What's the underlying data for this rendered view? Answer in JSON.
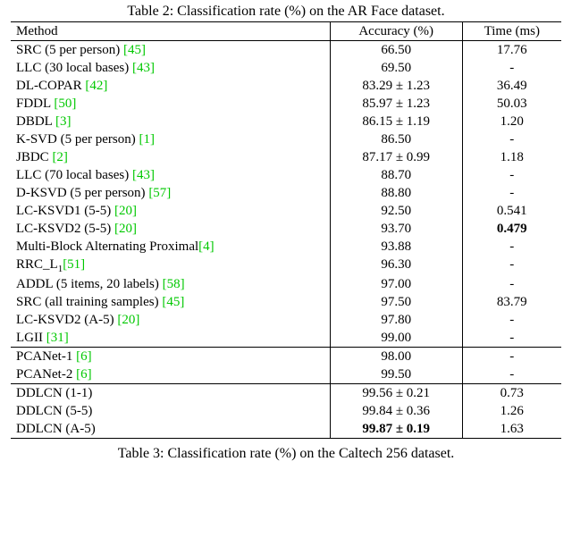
{
  "caption": "Table 2: Classification rate (%) on the AR Face dataset.",
  "post_caption": "Table 3: Classification rate (%) on the Caltech 256 dataset.",
  "headers": {
    "method": "Method",
    "accuracy": "Accuracy (%)",
    "time": "Time (ms)"
  },
  "groups": [
    {
      "rows": [
        {
          "name": "SRC (5 per person) ",
          "cite": "[45]",
          "acc": "66.50",
          "time": "17.76"
        },
        {
          "name": "LLC (30 local bases) ",
          "cite": "[43]",
          "acc": "69.50",
          "time": "-"
        },
        {
          "name": "DL-COPAR ",
          "cite": "[42]",
          "acc": "83.29 ± 1.23",
          "time": "36.49"
        },
        {
          "name": "FDDL ",
          "cite": "[50]",
          "acc": "85.97 ± 1.23",
          "time": "50.03"
        },
        {
          "name": "DBDL ",
          "cite": "[3]",
          "acc": "86.15 ± 1.19",
          "time": "1.20"
        },
        {
          "name": "K-SVD (5 per person) ",
          "cite": "[1]",
          "acc": "86.50",
          "time": "-"
        },
        {
          "name": "JBDC ",
          "cite": "[2]",
          "acc": "87.17 ± 0.99",
          "time": "1.18"
        },
        {
          "name": "LLC (70 local bases) ",
          "cite": "[43]",
          "acc": "88.70",
          "time": "-"
        },
        {
          "name": "D-KSVD (5 per person) ",
          "cite": "[57]",
          "acc": "88.80",
          "time": "-"
        },
        {
          "name": "LC-KSVD1 (5-5) ",
          "cite": "[20]",
          "acc": "92.50",
          "time": "0.541"
        },
        {
          "name": "LC-KSVD2 (5-5) ",
          "cite": "[20]",
          "acc": "93.70",
          "time_bold": "0.479"
        },
        {
          "name": "Multi-Block Alternating Proximal",
          "cite": "[4]",
          "acc": "93.88",
          "time": "-"
        },
        {
          "name_special": "RRC_L1",
          "cite": "[51]",
          "acc": "96.30",
          "time": "-"
        },
        {
          "name": "ADDL (5 items, 20 labels) ",
          "cite": "[58]",
          "acc": "97.00",
          "time": "-"
        },
        {
          "name": "SRC (all training samples) ",
          "cite": "[45]",
          "acc": "97.50",
          "time": "83.79"
        },
        {
          "name": "LC-KSVD2 (A-5) ",
          "cite": "[20]",
          "acc": "97.80",
          "time": "-"
        },
        {
          "name": "LGII ",
          "cite": "[31]",
          "acc": "99.00",
          "time": "-"
        }
      ]
    },
    {
      "rows": [
        {
          "name": "PCANet-1 ",
          "cite": "[6]",
          "acc": "98.00",
          "time": "-"
        },
        {
          "name": "PCANet-2 ",
          "cite": "[6]",
          "acc": "99.50",
          "time": "-"
        }
      ]
    },
    {
      "rows": [
        {
          "name": "DDLCN (1-1)",
          "acc": "99.56 ± 0.21",
          "time": "0.73"
        },
        {
          "name": "DDLCN (5-5)",
          "acc": "99.84 ± 0.36",
          "time": "1.26"
        },
        {
          "name": "DDLCN (A-5)",
          "acc_bold": "99.87 ± 0.19",
          "time": "1.63"
        }
      ]
    }
  ],
  "chart_data": {
    "type": "table",
    "title": "Classification rate (%) on the AR Face dataset",
    "columns": [
      "Method",
      "Accuracy (%)",
      "Time (ms)"
    ],
    "rows": [
      [
        "SRC (5 per person) [45]",
        "66.50",
        "17.76"
      ],
      [
        "LLC (30 local bases) [43]",
        "69.50",
        "-"
      ],
      [
        "DL-COPAR [42]",
        "83.29 ± 1.23",
        "36.49"
      ],
      [
        "FDDL [50]",
        "85.97 ± 1.23",
        "50.03"
      ],
      [
        "DBDL [3]",
        "86.15 ± 1.19",
        "1.20"
      ],
      [
        "K-SVD (5 per person) [1]",
        "86.50",
        "-"
      ],
      [
        "JBDC [2]",
        "87.17 ± 0.99",
        "1.18"
      ],
      [
        "LLC (70 local bases) [43]",
        "88.70",
        "-"
      ],
      [
        "D-KSVD (5 per person) [57]",
        "88.80",
        "-"
      ],
      [
        "LC-KSVD1 (5-5) [20]",
        "92.50",
        "0.541"
      ],
      [
        "LC-KSVD2 (5-5) [20]",
        "93.70",
        "0.479"
      ],
      [
        "Multi-Block Alternating Proximal [4]",
        "93.88",
        "-"
      ],
      [
        "RRC_L1 [51]",
        "96.30",
        "-"
      ],
      [
        "ADDL (5 items, 20 labels) [58]",
        "97.00",
        "-"
      ],
      [
        "SRC (all training samples) [45]",
        "97.50",
        "83.79"
      ],
      [
        "LC-KSVD2 (A-5) [20]",
        "97.80",
        "-"
      ],
      [
        "LGII [31]",
        "99.00",
        "-"
      ],
      [
        "PCANet-1 [6]",
        "98.00",
        "-"
      ],
      [
        "PCANet-2 [6]",
        "99.50",
        "-"
      ],
      [
        "DDLCN (1-1)",
        "99.56 ± 0.21",
        "0.73"
      ],
      [
        "DDLCN (5-5)",
        "99.84 ± 0.36",
        "1.26"
      ],
      [
        "DDLCN (A-5)",
        "99.87 ± 0.19",
        "1.63"
      ]
    ]
  }
}
